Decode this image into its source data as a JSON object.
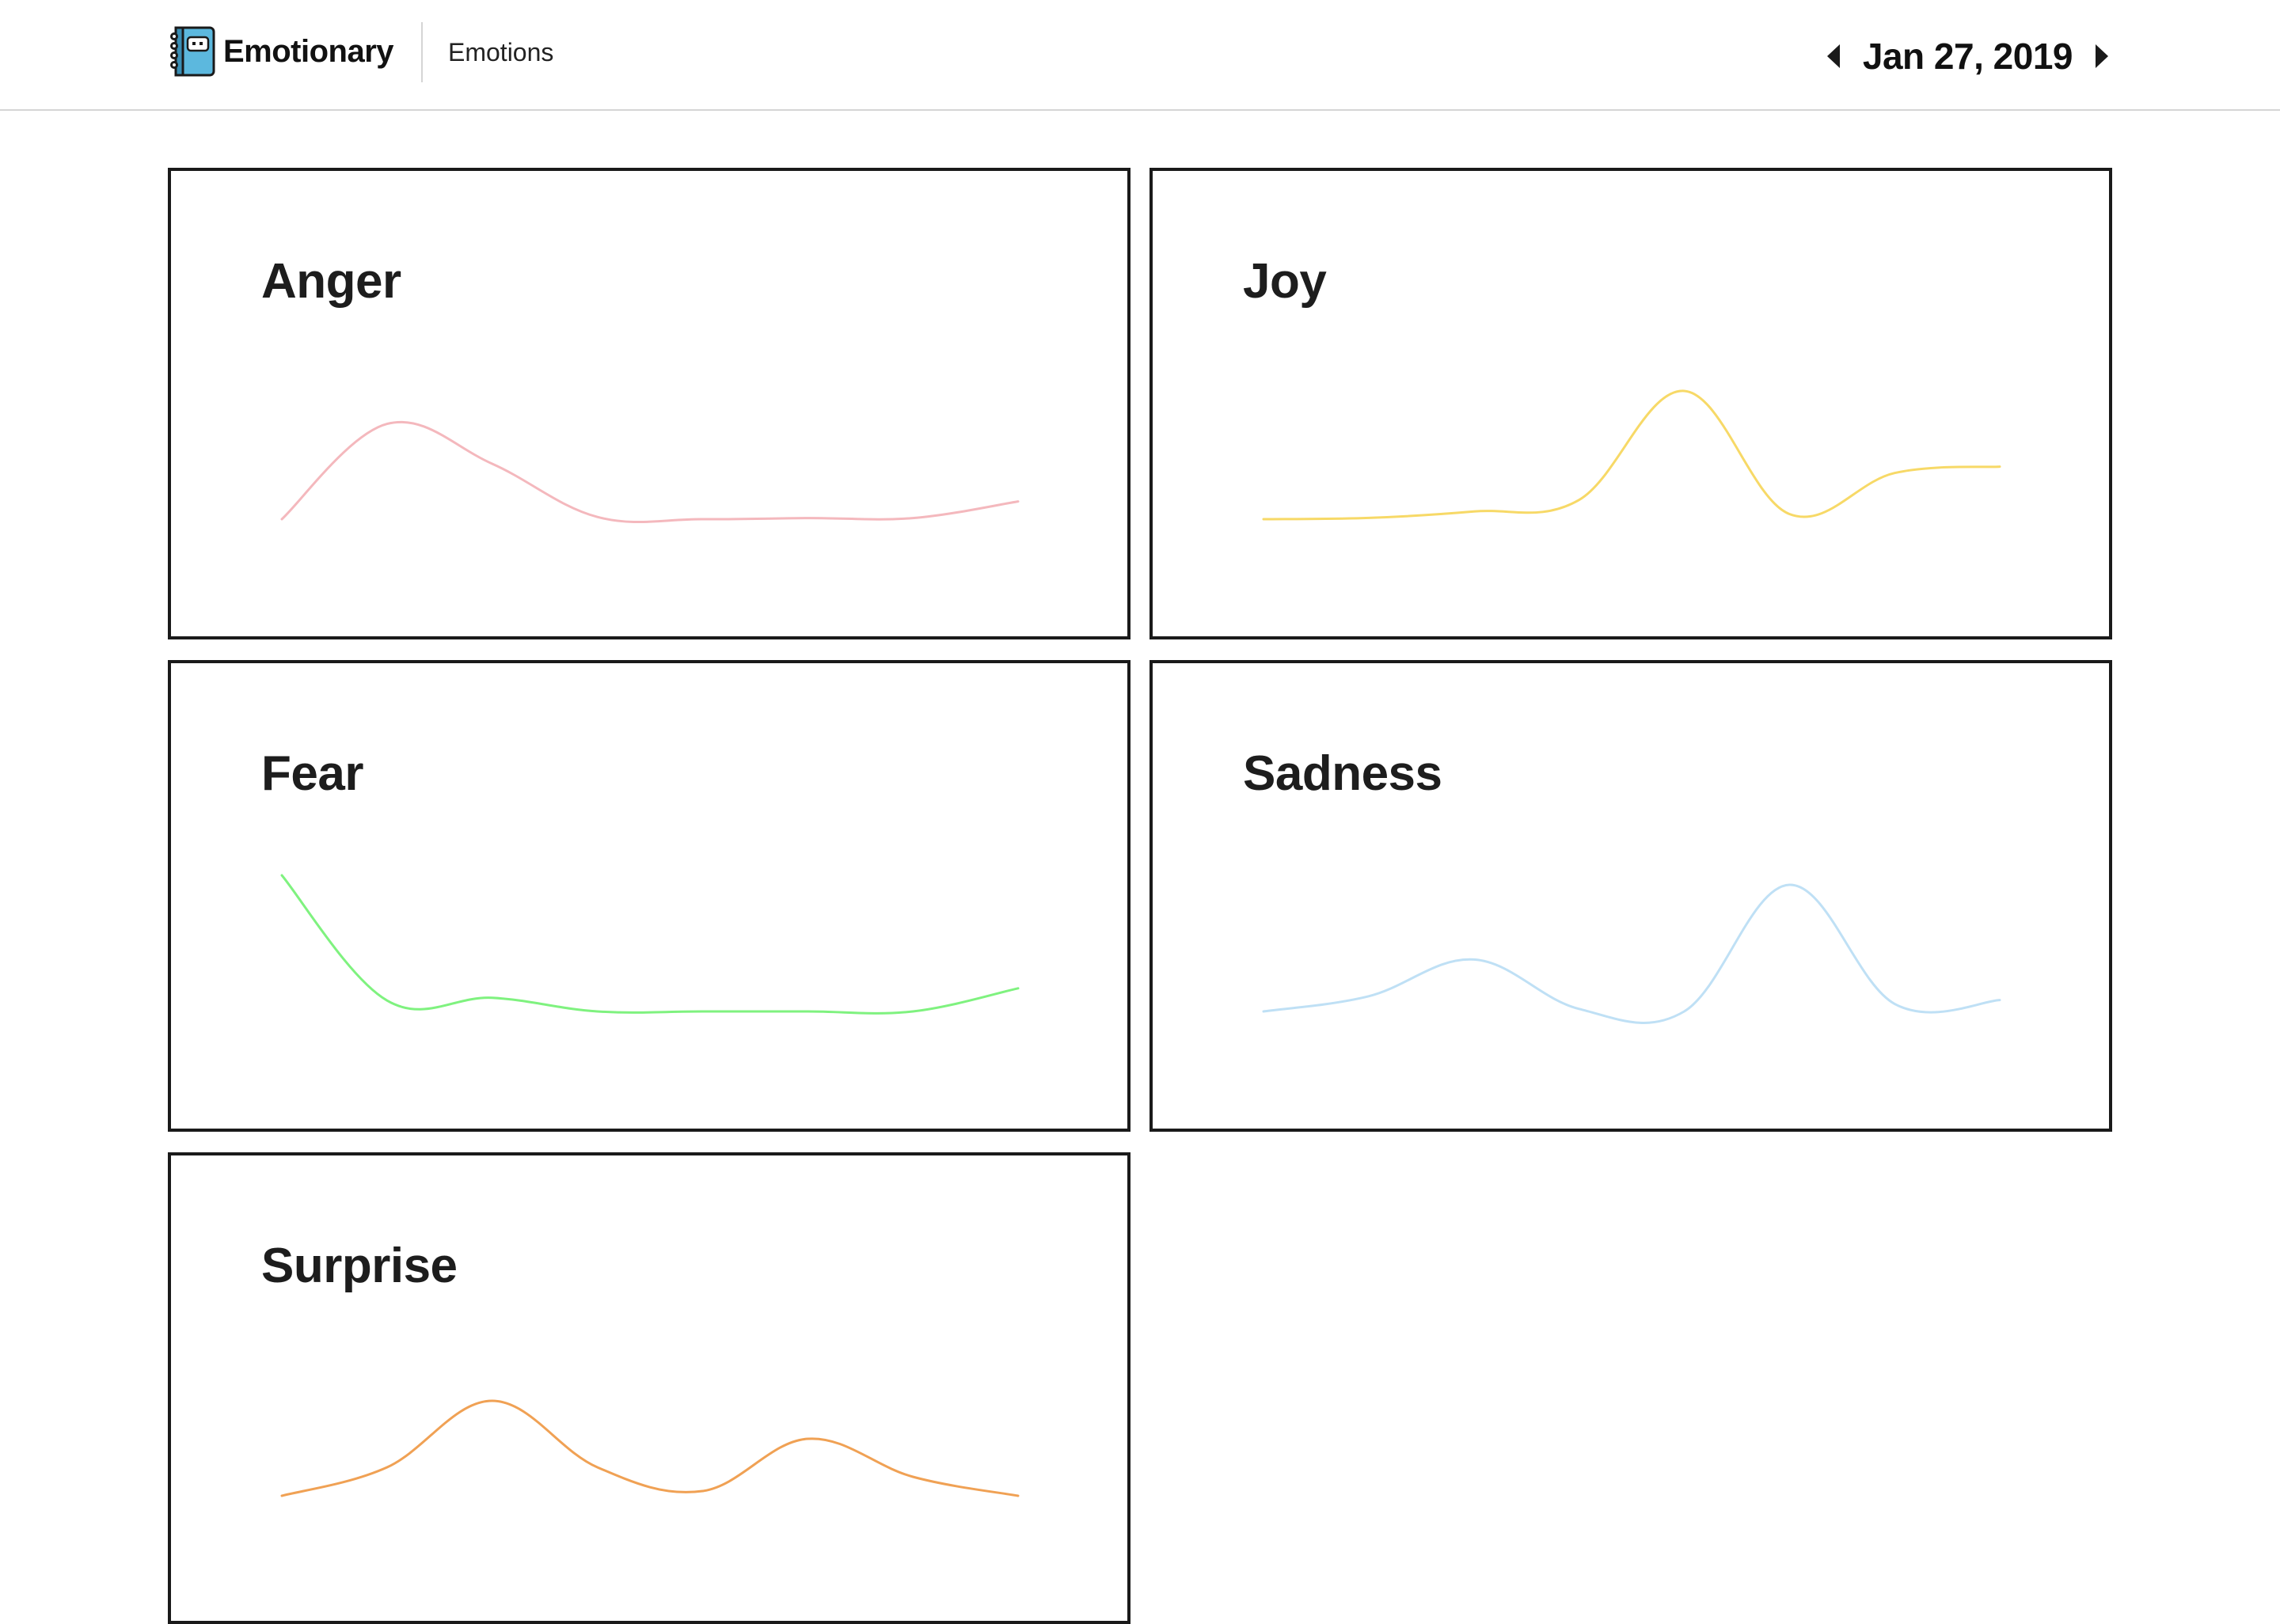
{
  "app": {
    "name": "Emotionary",
    "logo_icon": "notebook-face-icon"
  },
  "nav": {
    "emotions_label": "Emotions"
  },
  "date_nav": {
    "date": "Jan 27, 2019",
    "prev_icon": "caret-left-icon",
    "next_icon": "caret-right-icon"
  },
  "cards": [
    {
      "key": "anger",
      "title": "Anger",
      "color": "#f4b8bd"
    },
    {
      "key": "joy",
      "title": "Joy",
      "color": "#f7d967"
    },
    {
      "key": "fear",
      "title": "Fear",
      "color": "#7ff27f"
    },
    {
      "key": "sadness",
      "title": "Sadness",
      "color": "#bfe0f5"
    },
    {
      "key": "surprise",
      "title": "Surprise",
      "color": "#f0a154"
    }
  ],
  "chart_data": [
    {
      "type": "line",
      "series": [
        {
          "values": [
            0.0,
            0.86,
            0.5,
            0.02,
            0.0,
            0.01,
            0.01,
            0.16
          ]
        }
      ]
    },
    {
      "type": "line",
      "series": [
        {
          "values": [
            0.0,
            0.01,
            0.06,
            0.15,
            1.0,
            0.04,
            0.36,
            0.41
          ]
        }
      ]
    },
    {
      "type": "line",
      "series": [
        {
          "values": [
            1.0,
            0.08,
            0.1,
            0.0,
            0.0,
            0.0,
            0.0,
            0.17
          ]
        }
      ]
    },
    {
      "type": "line",
      "series": [
        {
          "values": [
            0.0,
            0.12,
            0.41,
            0.02,
            0.0,
            1.0,
            0.06,
            0.09
          ]
        }
      ]
    },
    {
      "type": "line",
      "series": [
        {
          "values": [
            0.0,
            0.3,
            1.0,
            0.3,
            0.05,
            0.6,
            0.2,
            0.0
          ]
        }
      ]
    }
  ]
}
